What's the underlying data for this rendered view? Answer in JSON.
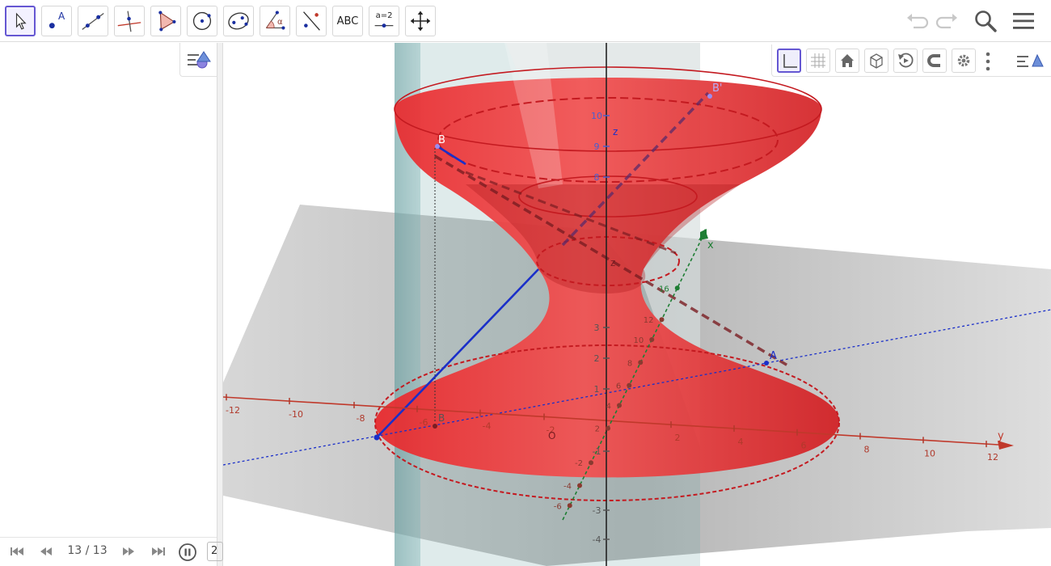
{
  "toolbar": {
    "tools": [
      {
        "name": "move-tool",
        "icon": "arrow-cursor-icon",
        "selected": true
      },
      {
        "name": "point-tool",
        "icon": "point-icon",
        "label": "A"
      },
      {
        "name": "line-tool",
        "icon": "line-icon"
      },
      {
        "name": "perpendicular-line-tool",
        "icon": "perpendicular-icon"
      },
      {
        "name": "polygon-tool",
        "icon": "polygon-icon"
      },
      {
        "name": "circle-tool",
        "icon": "circle-icon"
      },
      {
        "name": "conic-tool",
        "icon": "conic-icon"
      },
      {
        "name": "angle-tool",
        "icon": "angle-icon",
        "label": "α"
      },
      {
        "name": "reflect-tool",
        "icon": "reflect-icon"
      },
      {
        "name": "text-tool",
        "icon": "text-icon",
        "label": "ABC"
      },
      {
        "name": "slider-tool",
        "icon": "slider-icon",
        "label": "a=2"
      },
      {
        "name": "move-view-tool",
        "icon": "move-arrows-icon"
      }
    ],
    "right_icons": [
      "undo-icon",
      "redo-icon",
      "search-icon",
      "menu-icon"
    ]
  },
  "player": {
    "step": "13 / 13",
    "speed": "2",
    "icons": [
      "first-step-icon",
      "previous-step-icon",
      "next-step-icon",
      "last-step-icon",
      "pause-icon"
    ]
  },
  "graphics_style_bar": {
    "icons": [
      "axes-icon",
      "grid-icon",
      "home-icon",
      "view-cube-icon",
      "rotate-view-icon",
      "projection-icon",
      "settings-icon",
      "more-vertical-icon",
      "style-bar-toggle-icon"
    ]
  },
  "scene": {
    "points": {
      "B": "B",
      "B_prime": "B'",
      "A": "A",
      "O": "O",
      "z": "z"
    },
    "axes": {
      "x_label": "x",
      "y_label": "y",
      "z_label": "z",
      "y_ticks": [
        "-12",
        "-10",
        "-8",
        "-6",
        "-4",
        "-2",
        "2",
        "4",
        "6",
        "8",
        "10",
        "12"
      ],
      "x_ticks": [
        "16",
        "12",
        "10",
        "8",
        "6",
        "4",
        "2",
        "-2",
        "-4",
        "-6"
      ],
      "z_ticks": [
        "10",
        "9",
        "8",
        "3",
        "2",
        "1",
        "-1",
        "-3",
        "-4"
      ]
    },
    "colors": {
      "surface": "#e8262a",
      "plane": "#7a7a7a",
      "cylinder_wall": "#6ea3a6",
      "y_axis": "#c0392b",
      "x_axis": "#1e7e34",
      "z_axis": "#222222",
      "blue_line": "#1a2fc9",
      "accent": "#6557d2"
    }
  }
}
